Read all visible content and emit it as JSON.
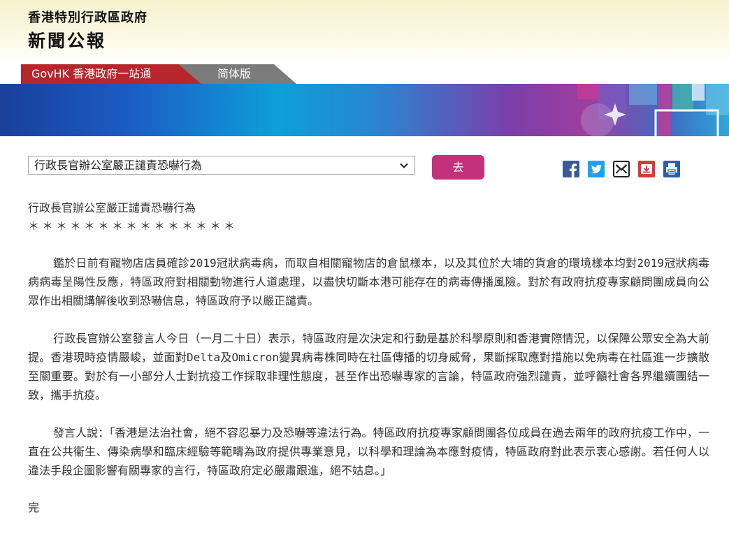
{
  "header": {
    "line1": "香港特別行政區政府",
    "line2": "新聞公報"
  },
  "tabs": [
    {
      "label": "GovHK 香港政府一站通"
    },
    {
      "label": "简体版"
    }
  ],
  "nav": {
    "selected_article": "行政長官辦公室嚴正譴責恐嚇行為",
    "go_label": "去"
  },
  "share_icons": [
    "facebook-icon",
    "twitter-icon",
    "email-icon",
    "download-icon",
    "print-icon"
  ],
  "colors": {
    "tab_govhk": "#b6272d",
    "tab_simplified": "#7b7b7b",
    "go_button": "#c2317a",
    "facebook": "#3b5998",
    "twitter": "#1da1f2",
    "download": "#d93a3a",
    "print": "#2a5caa"
  },
  "article": {
    "title": "行政長官辦公室嚴正譴責恐嚇行為",
    "stars": "＊＊＊＊＊＊＊＊＊＊＊＊＊＊＊",
    "paragraphs": [
      "鑑於日前有寵物店店員確診2019冠狀病毒病，而取自相關寵物店的倉鼠樣本，以及其位於大埔的貨倉的環境樣本均對2019冠狀病毒病病毒呈陽性反應，特區政府對相關動物進行人道處理，以盡快切斷本港可能存在的病毒傳播風險。對於有政府抗疫專家顧問團成員向公眾作出相關講解後收到恐嚇信息，特區政府予以嚴正譴責。",
      "行政長官辦公室發言人今日（一月二十日）表示，特區政府是次決定和行動是基於科學原則和香港實際情況，以保障公眾安全為大前提。香港現時疫情嚴峻，並面對Delta及Omicron變異病毒株同時在社區傳播的切身威脅，果斷採取應對措施以免病毒在社區進一步擴散至關重要。對於有一小部分人士對抗疫工作採取非理性態度，甚至作出恐嚇專家的言論，特區政府強烈譴責，並呼籲社會各界繼續團結一致，攜手抗疫。",
      "發言人說：「香港是法治社會，絕不容忍暴力及恐嚇等違法行為。特區政府抗疫專家顧問團各位成員在過去兩年的政府抗疫工作中，一直在公共衞生、傳染病學和臨床經驗等範疇為政府提供專業意見，以科學和理論為本應對疫情，特區政府對此表示衷心感謝。若任何人以違法手段企圖影響有關專家的言行，特區政府定必嚴肅跟進，絕不姑息。」"
    ],
    "end": "完"
  }
}
